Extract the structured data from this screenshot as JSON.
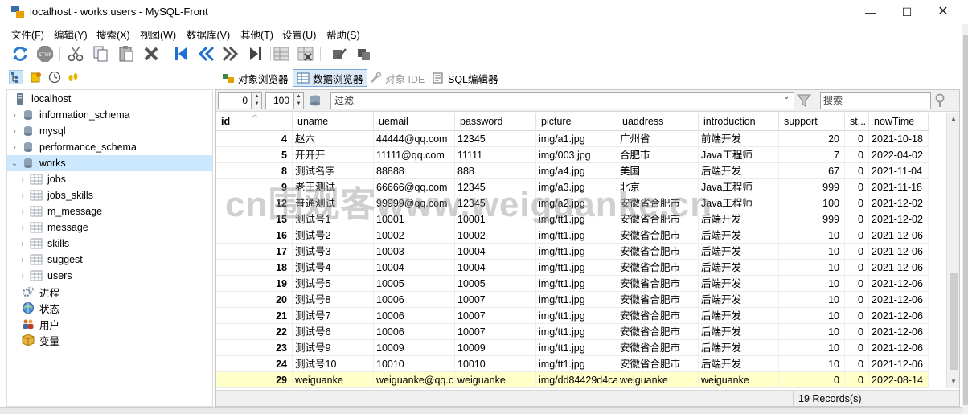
{
  "window": {
    "title": "localhost - works.users - MySQL-Front",
    "min_glyph": "—",
    "max_glyph": "☐",
    "close_glyph": "✕"
  },
  "menu": [
    "文件(F)",
    "编辑(Y)",
    "搜索(X)",
    "视图(W)",
    "数据库(V)",
    "其他(T)",
    "设置(U)",
    "帮助(S)"
  ],
  "toolbar": {
    "buttons": [
      "refresh-icon",
      "stop-icon",
      "cut-icon",
      "copy-icon",
      "paste-icon",
      "delete-icon",
      "first-icon",
      "prev-icon",
      "next-icon",
      "last-icon",
      "insert-row-icon",
      "delete-row-icon",
      "post-icon",
      "cancel-icon"
    ]
  },
  "views": {
    "tabs": [
      {
        "label": "对象浏览器",
        "active": false,
        "disabled": false
      },
      {
        "label": "数据浏览器",
        "active": true,
        "disabled": false
      },
      {
        "label": "对象 IDE",
        "active": false,
        "disabled": true
      },
      {
        "label": "SQL编辑器",
        "active": false,
        "disabled": false
      }
    ]
  },
  "tree": {
    "root": "localhost",
    "items": [
      {
        "label": "information_schema",
        "type": "database",
        "expanded": false
      },
      {
        "label": "mysql",
        "type": "database",
        "expanded": false
      },
      {
        "label": "performance_schema",
        "type": "database",
        "expanded": false
      },
      {
        "label": "works",
        "type": "database",
        "expanded": true,
        "selected": true
      },
      {
        "label": "jobs",
        "type": "table"
      },
      {
        "label": "jobs_skills",
        "type": "table"
      },
      {
        "label": "m_message",
        "type": "table"
      },
      {
        "label": "message",
        "type": "table"
      },
      {
        "label": "skills",
        "type": "table"
      },
      {
        "label": "suggest",
        "type": "table"
      },
      {
        "label": "users",
        "type": "table"
      }
    ],
    "extras": [
      {
        "label": "进程",
        "icon": "gears-icon"
      },
      {
        "label": "状态",
        "icon": "globe-icon"
      },
      {
        "label": "用户",
        "icon": "users-icon"
      },
      {
        "label": "变量",
        "icon": "box-icon"
      }
    ]
  },
  "filter": {
    "offset": "0",
    "limit": "100",
    "placeholder": "过滤",
    "search_placeholder": "搜索"
  },
  "grid": {
    "columns": [
      "id",
      "uname",
      "uemail",
      "password",
      "picture",
      "uaddress",
      "introduction",
      "support",
      "st...",
      "nowTime"
    ],
    "rows": [
      [
        "4",
        "赵六",
        "44444@qq.com",
        "12345",
        "img/a1.jpg",
        "广州省",
        "前端开发",
        "20",
        "0",
        "2021-10-18"
      ],
      [
        "5",
        "开开开",
        "11111@qq.com",
        "11111",
        "img/003.jpg",
        "合肥市",
        "Java工程师",
        "7",
        "0",
        "2022-04-02"
      ],
      [
        "8",
        "测试名字",
        "88888",
        "888",
        "img/a4.jpg",
        "美国",
        "后端开发",
        "67",
        "0",
        "2021-11-04"
      ],
      [
        "9",
        "老王测试",
        "66666@qq.com",
        "12345",
        "img/a3.jpg",
        "北京",
        "Java工程师",
        "999",
        "0",
        "2021-11-18"
      ],
      [
        "12",
        "普通测试",
        "99999@qq.com",
        "12345",
        "img/a2.jpg",
        "安徽省合肥市",
        "Java工程师",
        "100",
        "0",
        "2021-12-02"
      ],
      [
        "15",
        "测试号1",
        "10001",
        "10001",
        "img/tt1.jpg",
        "安徽省合肥市",
        "后端开发",
        "999",
        "0",
        "2021-12-02"
      ],
      [
        "16",
        "测试号2",
        "10002",
        "10002",
        "img/tt1.jpg",
        "安徽省合肥市",
        "后端开发",
        "10",
        "0",
        "2021-12-06"
      ],
      [
        "17",
        "测试号3",
        "10003",
        "10004",
        "img/tt1.jpg",
        "安徽省合肥市",
        "后端开发",
        "10",
        "0",
        "2021-12-06"
      ],
      [
        "18",
        "测试号4",
        "10004",
        "10004",
        "img/tt1.jpg",
        "安徽省合肥市",
        "后端开发",
        "10",
        "0",
        "2021-12-06"
      ],
      [
        "19",
        "测试号5",
        "10005",
        "10005",
        "img/tt1.jpg",
        "安徽省合肥市",
        "后端开发",
        "10",
        "0",
        "2021-12-06"
      ],
      [
        "20",
        "测试号8",
        "10006",
        "10007",
        "img/tt1.jpg",
        "安徽省合肥市",
        "后端开发",
        "10",
        "0",
        "2021-12-06"
      ],
      [
        "21",
        "测试号7",
        "10006",
        "10007",
        "img/tt1.jpg",
        "安徽省合肥市",
        "后端开发",
        "10",
        "0",
        "2021-12-06"
      ],
      [
        "22",
        "测试号6",
        "10006",
        "10007",
        "img/tt1.jpg",
        "安徽省合肥市",
        "后端开发",
        "10",
        "0",
        "2021-12-06"
      ],
      [
        "23",
        "测试号9",
        "10009",
        "10009",
        "img/tt1.jpg",
        "安徽省合肥市",
        "后端开发",
        "10",
        "0",
        "2021-12-06"
      ],
      [
        "24",
        "测试号10",
        "10010",
        "10010",
        "img/tt1.jpg",
        "安徽省合肥市",
        "后端开发",
        "10",
        "0",
        "2021-12-06"
      ],
      [
        "29",
        "weiguanke",
        "weiguanke@qq.c",
        "weiguanke",
        "img/dd84429d4ca",
        "weiguanke",
        "weiguanke",
        "0",
        "0",
        "2022-08-14"
      ]
    ],
    "highlighted_row": 15
  },
  "status": {
    "records": "19 Records(s)"
  },
  "watermark": "cn围观客www.weiguanke.cn",
  "colors": {
    "selection": "#cce8ff",
    "new_row": "#ffffc8",
    "active_tab": "#dceaf8"
  }
}
